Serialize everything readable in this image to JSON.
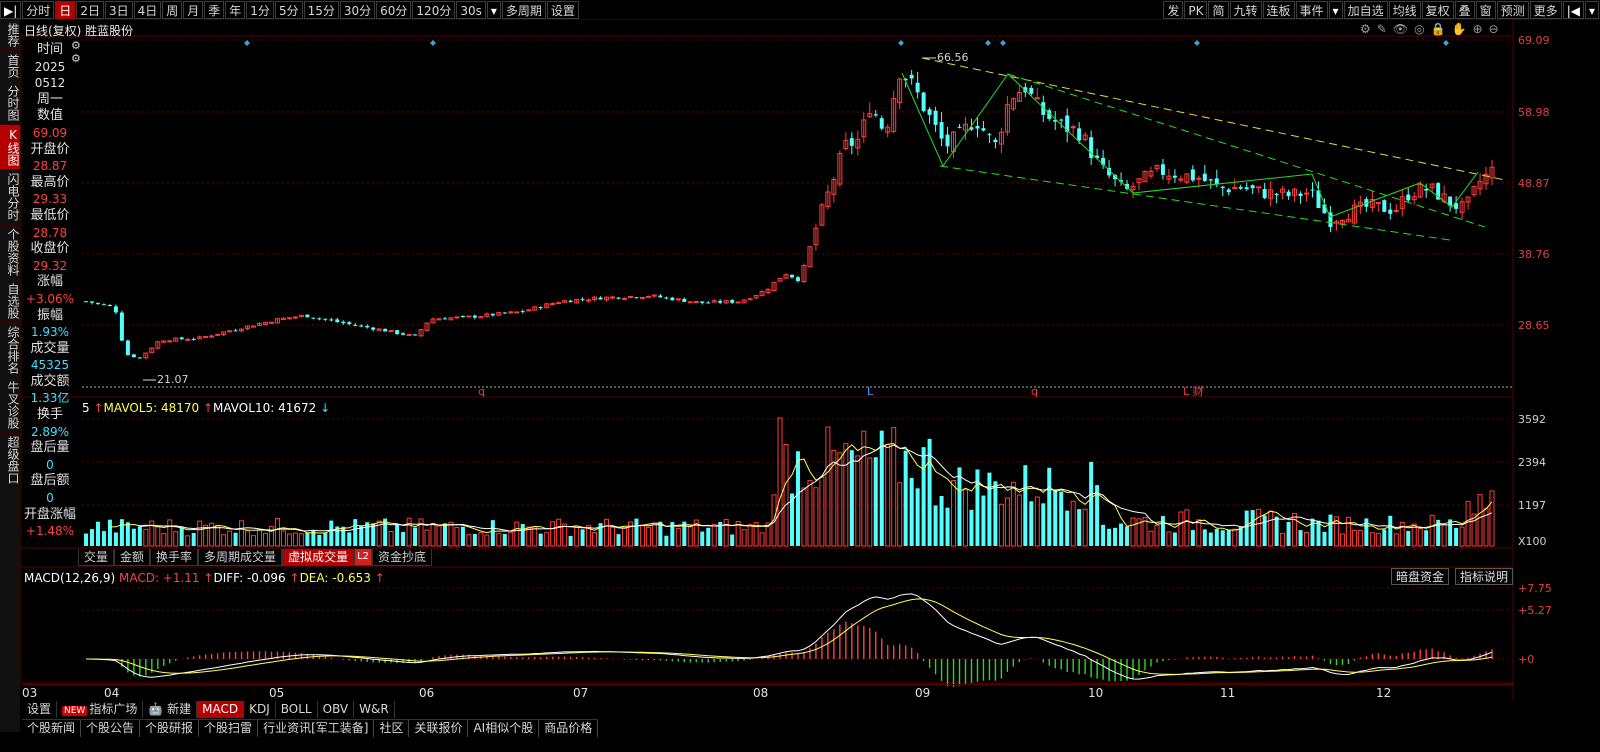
{
  "toolbar": {
    "left": [
      {
        "label": "▶|",
        "name": "play-icon",
        "icon": true
      },
      {
        "label": "分时",
        "name": "tab-intraday"
      },
      {
        "label": "日",
        "name": "tab-day",
        "active": true
      },
      {
        "label": "2日",
        "name": "tab-2day"
      },
      {
        "label": "3日",
        "name": "tab-3day"
      },
      {
        "label": "4日",
        "name": "tab-4day"
      },
      {
        "label": "周",
        "name": "tab-week"
      },
      {
        "label": "月",
        "name": "tab-month"
      },
      {
        "label": "季",
        "name": "tab-quarter"
      },
      {
        "label": "年",
        "name": "tab-year"
      },
      {
        "label": "1分",
        "name": "tab-1min"
      },
      {
        "label": "5分",
        "name": "tab-5min"
      },
      {
        "label": "15分",
        "name": "tab-15min"
      },
      {
        "label": "30分",
        "name": "tab-30min"
      },
      {
        "label": "60分",
        "name": "tab-60min"
      },
      {
        "label": "120分",
        "name": "tab-120min"
      },
      {
        "label": "30s",
        "name": "tab-30s"
      },
      {
        "label": "▾",
        "name": "period-dropdown-icon",
        "icon": true
      },
      {
        "label": "多周期",
        "name": "multi-period-button"
      },
      {
        "label": "设置",
        "name": "settings-button"
      }
    ],
    "right": [
      {
        "label": "发",
        "name": "publish-button"
      },
      {
        "label": "PK",
        "name": "pk-button"
      },
      {
        "label": "简",
        "name": "simple-button"
      },
      {
        "label": "九转",
        "name": "nine-turn-button"
      },
      {
        "label": "连板",
        "name": "limit-board-button"
      },
      {
        "label": "事件",
        "name": "event-button"
      },
      {
        "label": "▾",
        "name": "event-dropdown-icon",
        "icon": true
      },
      {
        "label": "加自选",
        "name": "add-watchlist-button"
      },
      {
        "label": "均线",
        "name": "ma-button"
      },
      {
        "label": "复权",
        "name": "adjust-button"
      },
      {
        "label": "叠",
        "name": "overlay-button"
      },
      {
        "label": "窗",
        "name": "window-button"
      },
      {
        "label": "预测",
        "name": "forecast-button"
      },
      {
        "label": "更多",
        "name": "more-button"
      },
      {
        "label": "|◀",
        "name": "collapse-icon",
        "icon": true
      },
      {
        "label": "▾",
        "name": "more-dropdown-icon",
        "icon": true
      }
    ]
  },
  "leftnav": [
    {
      "label": "推荐",
      "name": "nav-recommend"
    },
    {
      "label": "首页",
      "name": "nav-home"
    },
    {
      "label": "分时图",
      "name": "nav-intraday-chart"
    },
    {
      "label": "K线图",
      "name": "nav-kline-chart",
      "active": true
    },
    {
      "label": "闪电分时",
      "name": "nav-flash-intraday"
    },
    {
      "label": "个股资料",
      "name": "nav-stock-profile"
    },
    {
      "label": "自选股",
      "name": "nav-watchlist"
    },
    {
      "label": "综合排名",
      "name": "nav-ranking"
    },
    {
      "label": "牛叉诊股",
      "name": "nav-diagnosis"
    },
    {
      "label": "超级盘口",
      "name": "nav-super-quote"
    }
  ],
  "chart": {
    "title": "日线(复权)  胜蓝股份",
    "tools": [
      "⚙",
      "✎",
      "👁",
      "◎",
      "🔒",
      "✋",
      "⊕",
      "⊖"
    ],
    "price_axis": [
      "69.09",
      "58.98",
      "48.87",
      "38.76",
      "28.65"
    ],
    "high_label": "66.56",
    "low_label": "21.07",
    "event_markers": [
      "q",
      "L",
      "q",
      "L 财"
    ]
  },
  "info": [
    {
      "label": "时间",
      "value": "2025",
      "value2": "0512",
      "value3": "周一",
      "vc": "white"
    },
    {
      "label": "数值",
      "value": "69.09",
      "vc": "red"
    },
    {
      "label": "开盘价",
      "value": "28.87",
      "vc": "red"
    },
    {
      "label": "最高价",
      "value": "29.33",
      "vc": "red"
    },
    {
      "label": "最低价",
      "value": "28.78",
      "vc": "red"
    },
    {
      "label": "收盘价",
      "value": "29.32",
      "vc": "red"
    },
    {
      "label": "涨幅",
      "value": "+3.06%",
      "vc": "red"
    },
    {
      "label": "振幅",
      "value": "1.93%",
      "vc": "cyan"
    },
    {
      "label": "成交量",
      "value": "45325",
      "vc": "cyan"
    },
    {
      "label": "成交额",
      "value": "1.33亿",
      "vc": "cyan"
    },
    {
      "label": "换手",
      "value": "2.89%",
      "vc": "cyan"
    },
    {
      "label": "盘后量",
      "value": "0",
      "vc": "cyan"
    },
    {
      "label": "盘后额",
      "value": "0",
      "vc": "cyan"
    },
    {
      "label": "开盘涨幅",
      "value": "+1.48%",
      "vc": "red"
    }
  ],
  "volume": {
    "legend_prefix": "5",
    "mavol5": "MAVOL5: 48170",
    "mavol10": "MAVOL10: 41672",
    "axis": [
      "3592",
      "2394",
      "1197",
      "X100"
    ],
    "tabs": [
      {
        "label": "交量",
        "name": "tab-volume"
      },
      {
        "label": "金额",
        "name": "tab-amount"
      },
      {
        "label": "换手率",
        "name": "tab-turnover"
      },
      {
        "label": "多周期成交量",
        "name": "tab-multi-volume"
      },
      {
        "label": "虚拟成交量",
        "name": "tab-virtual-volume",
        "active": true
      },
      {
        "label": "L2",
        "name": "l2-badge",
        "l2": true
      },
      {
        "label": "资金抄底",
        "name": "tab-fund-bottom"
      }
    ]
  },
  "macd": {
    "name": "MACD(12,26,9)",
    "macd": "MACD: +1.11",
    "diff": "DIFF: -0.096",
    "dea": "DEA: -0.653",
    "axis": [
      "+7.75",
      "+5.27",
      "+0"
    ],
    "buttons": [
      "暗盘资金",
      "指标说明"
    ]
  },
  "months": [
    "03",
    "04",
    "05",
    "06",
    "07",
    "08",
    "09",
    "10",
    "11",
    "12"
  ],
  "indicator_row": [
    {
      "label": "设置",
      "name": "indicator-settings"
    },
    {
      "label": "指标广场",
      "name": "indicator-plaza",
      "new": true
    },
    {
      "label": "新建",
      "name": "indicator-new",
      "robot": true
    },
    {
      "label": "MACD",
      "name": "indicator-macd",
      "active": true
    },
    {
      "label": "KDJ",
      "name": "indicator-kdj"
    },
    {
      "label": "BOLL",
      "name": "indicator-boll"
    },
    {
      "label": "OBV",
      "name": "indicator-obv"
    },
    {
      "label": "W&R",
      "name": "indicator-wr"
    }
  ],
  "news_row": [
    "个股新闻",
    "个股公告",
    "个股研报",
    "个股扫雷",
    "行业资讯[军工装备]",
    "社区",
    "关联报价",
    "AI相似个股",
    "商品价格"
  ],
  "colors": {
    "up": "#ff3b3b",
    "down": "#54ffff",
    "ma5": "#ffff55",
    "ma10": "#ffffff",
    "trend": "#22dd22",
    "upper": "#dddd44"
  }
}
